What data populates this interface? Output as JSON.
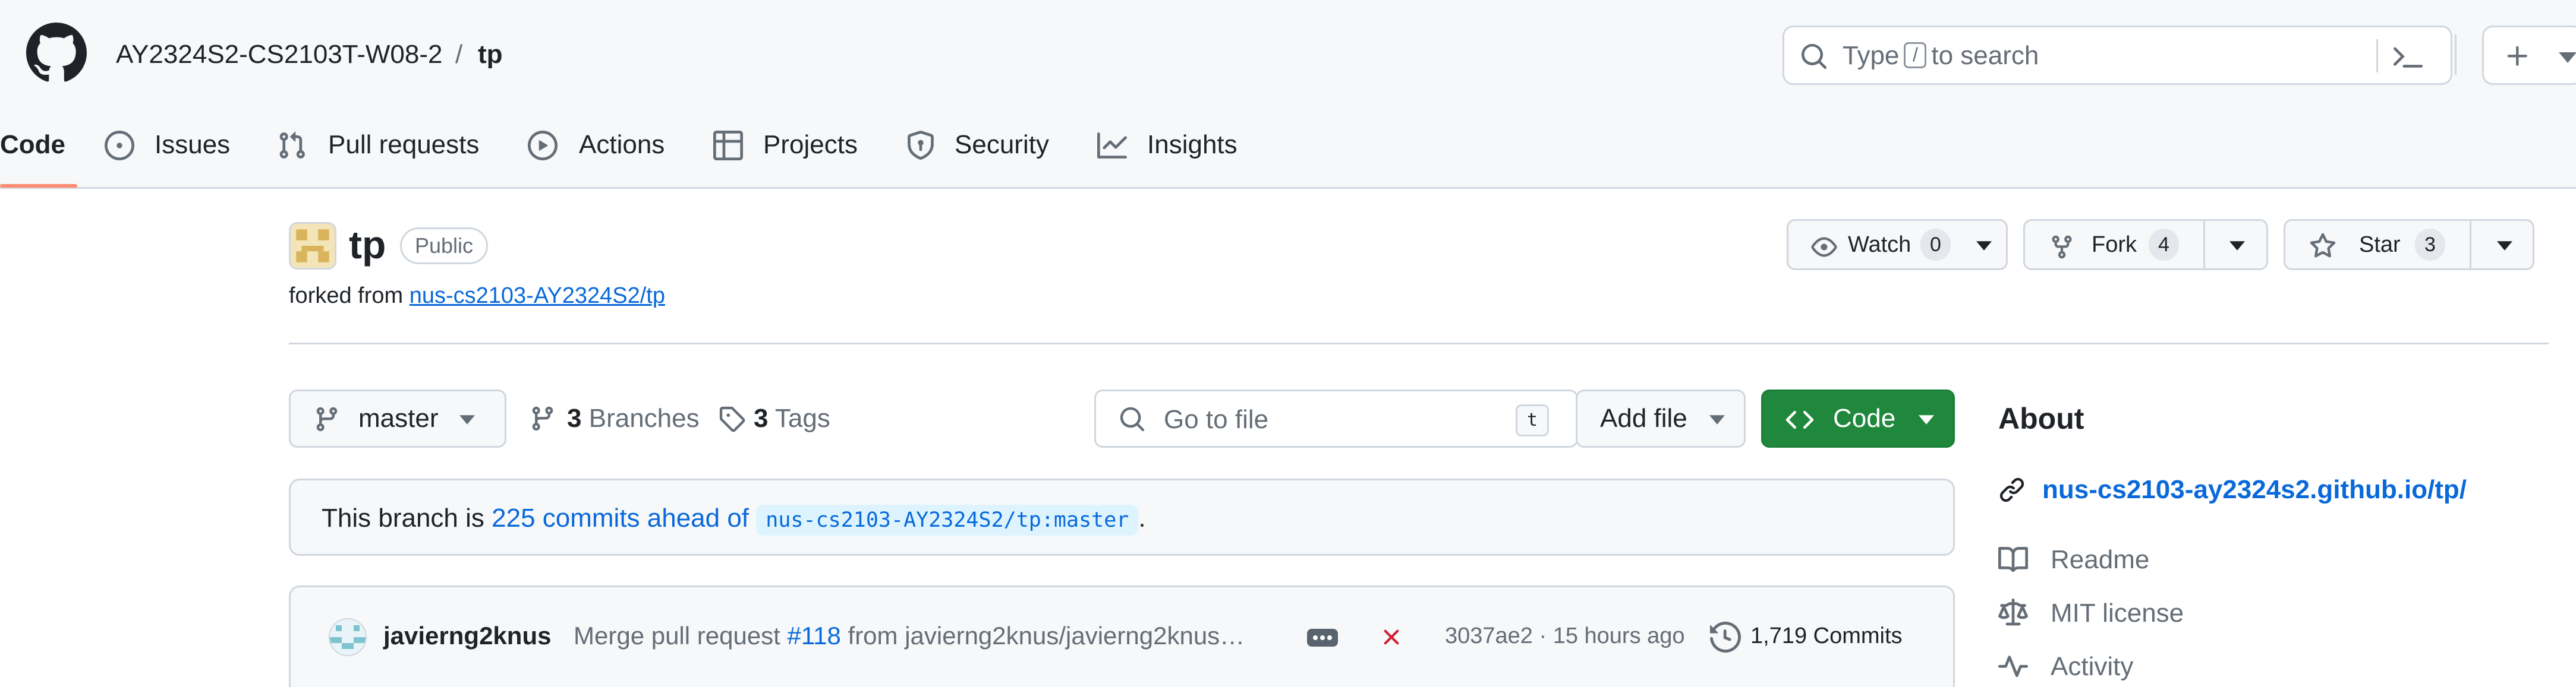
{
  "header": {
    "owner": "AY2324S2-CS2103T-W08-2",
    "separator": "/",
    "repo": "tp",
    "search_prefix": "Type",
    "search_key": "/",
    "search_suffix": "to search"
  },
  "tabs": [
    {
      "label": "Code",
      "icon": "code-icon",
      "active": true
    },
    {
      "label": "Issues",
      "icon": "issue-opened-icon"
    },
    {
      "label": "Pull requests",
      "icon": "git-pull-request-icon"
    },
    {
      "label": "Actions",
      "icon": "play-icon"
    },
    {
      "label": "Projects",
      "icon": "table-icon"
    },
    {
      "label": "Security",
      "icon": "shield-icon"
    },
    {
      "label": "Insights",
      "icon": "graph-icon"
    }
  ],
  "repo": {
    "name": "tp",
    "visibility": "Public",
    "forked_prefix": "forked from",
    "forked_source": "nus-cs2103-AY2324S2/tp"
  },
  "actions": {
    "watch_label": "Watch",
    "watch_count": "0",
    "fork_label": "Fork",
    "fork_count": "4",
    "star_label": "Star",
    "star_count": "3"
  },
  "toolbar": {
    "branch": "master",
    "branches_count": "3",
    "branches_label": "Branches",
    "tags_count": "3",
    "tags_label": "Tags",
    "goto_placeholder": "Go to file",
    "goto_key": "t",
    "add_file": "Add file",
    "code": "Code"
  },
  "ahead_banner": {
    "prefix": "This branch is",
    "link": "225 commits ahead of",
    "ref": "nus-cs2103-AY2324S2/tp:master",
    "suffix": "."
  },
  "latest_commit": {
    "author": "javierng2knus",
    "message_prefix": "Merge pull request",
    "pr": "#118",
    "message_suffix": "from javierng2knus/javierng2knus…",
    "sha_time": "3037ae2 · 15 hours ago",
    "commits": "1,719 Commits",
    "status": "failed"
  },
  "about": {
    "title": "About",
    "link": "nus-cs2103-ay2324s2.github.io/tp/",
    "items": [
      {
        "label": "Readme",
        "icon": "book-icon"
      },
      {
        "label": "MIT license",
        "icon": "law-icon"
      },
      {
        "label": "Activity",
        "icon": "pulse-icon"
      }
    ]
  },
  "colors": {
    "accent_link": "#0969da",
    "code_button": "#1f883d",
    "active_tab_underline": "#fd8c73",
    "failed_status": "#cf222e"
  }
}
